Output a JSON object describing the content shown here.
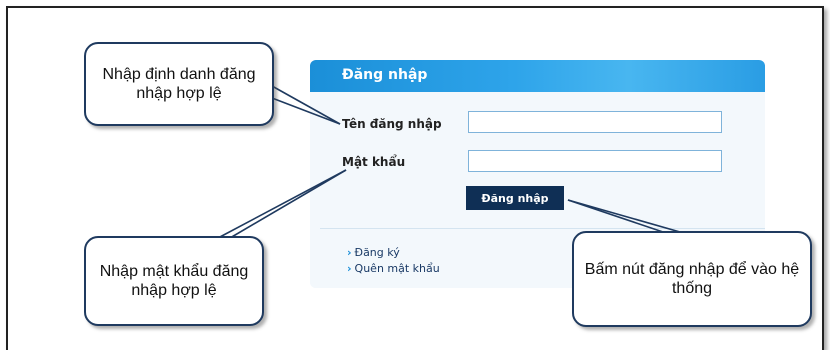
{
  "login_panel": {
    "title": "Đăng nhập",
    "username_label": "Tên đăng nhập",
    "password_label": "Mật khẩu",
    "username_value": "",
    "password_value": "",
    "submit_label": "Đăng nhập",
    "links": [
      {
        "label": "Đăng ký"
      },
      {
        "label": "Quên mật khẩu"
      }
    ],
    "colors": {
      "header": "#2ea4ea",
      "button": "#0f2f55",
      "background": "#eef5fb"
    }
  },
  "callouts": {
    "username": "Nhập định danh đăng nhập hợp lệ",
    "password": "Nhập mật khẩu đăng nhập hợp lệ",
    "button": "Bấm nút đăng nhập để vào hệ thống"
  }
}
